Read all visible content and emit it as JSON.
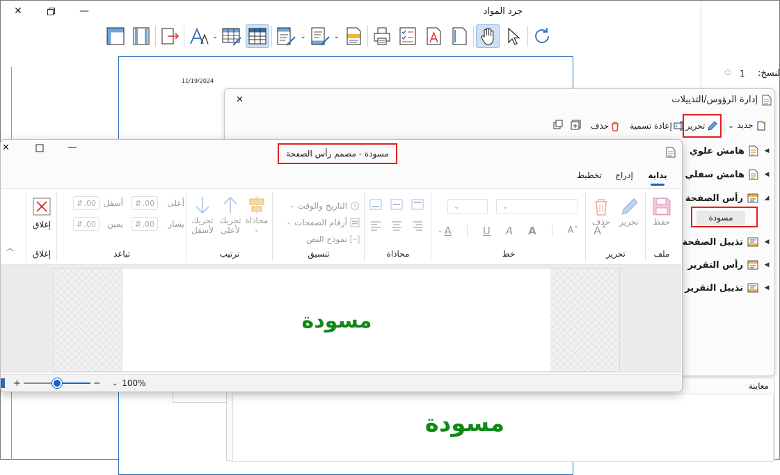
{
  "main": {
    "title": "جرد المواد",
    "report_date": "11/19/2024",
    "copies_label": "النسخ:",
    "copies_value": "1"
  },
  "manager": {
    "title": "إدارة الرؤوس/التذييلات",
    "toolbar": {
      "new": "جديد",
      "edit": "تحرير",
      "rename": "إعادة تسمية",
      "delete": "حذف"
    },
    "tree": {
      "top_margin": "هامش علوي",
      "bottom_margin": "هامش سفلي",
      "page_header": "رأس الصفحة",
      "page_header_child": "مسودة",
      "page_footer": "تذييل الصفحة",
      "report_header": "رأس التقرير",
      "report_footer": "تذييل التقرير"
    },
    "preview_label": "معاينة",
    "preview_text": "مسودة"
  },
  "designer": {
    "title": "مسودة - مصمم رأس الصفحة",
    "tabs": [
      "بداية",
      "إدراج",
      "تخطيط"
    ],
    "groups": {
      "file": {
        "label": "ملف",
        "save": "حفظ"
      },
      "edit": {
        "label": "تحرير",
        "edit": "تحرير",
        "delete": "حذف"
      },
      "font": {
        "label": "خط"
      },
      "align": {
        "label": "محاذاة"
      },
      "format": {
        "label": "تنسيق",
        "datetime": "التاريخ والوقت",
        "page_numbers": "أرقام الصفحات",
        "text_template": "نموذج النص"
      },
      "arrange": {
        "label": "ترتيب",
        "align": "محاذاة",
        "move_up_1": "تحريك",
        "move_up_2": "لأعلى",
        "move_down_1": "تحريك",
        "move_down_2": "لأسفل"
      },
      "spacing": {
        "label": "تباعد",
        "top": "أعلى",
        "bottom": "أسفل",
        "right": "يمين",
        "left": "يسار",
        "top_val": ".00",
        "bottom_val": ".00",
        "right_val": ".00",
        "left_val": ".00"
      },
      "close": {
        "label": "إغلاق",
        "close": "إغلاق"
      }
    },
    "canvas_text": "مسودة",
    "zoom": "100%",
    "zoom_fraction": 0.5
  },
  "colors": {
    "draft_green": "#0e8a16",
    "highlight_red": "#e0201f",
    "accent_blue": "#1464c8"
  }
}
